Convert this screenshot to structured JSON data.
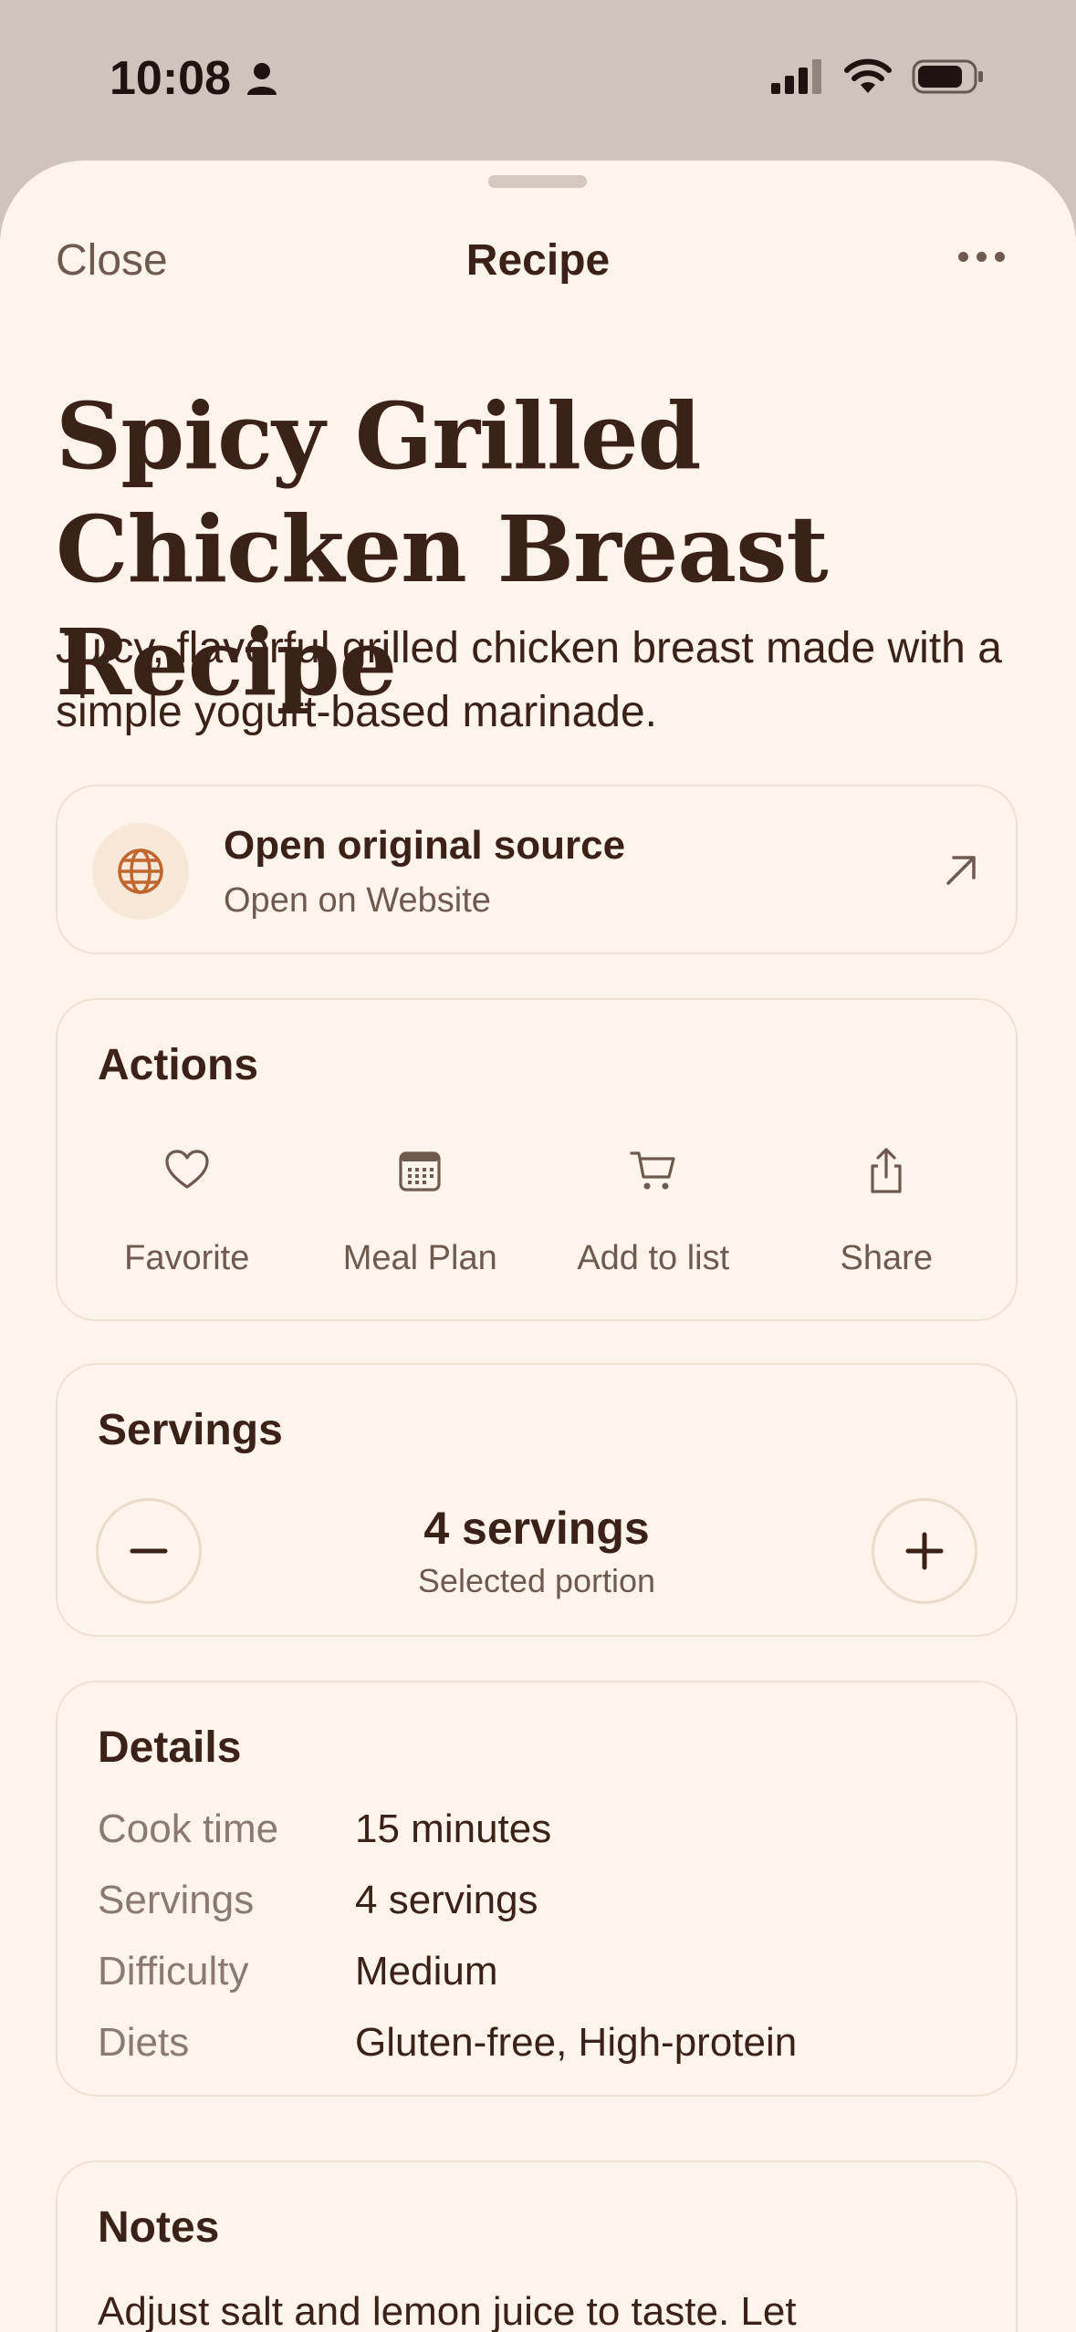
{
  "status_bar": {
    "time": "10:08",
    "icons": [
      "person-icon",
      "cellular-signal-icon",
      "wifi-icon",
      "battery-icon"
    ]
  },
  "nav": {
    "close_label": "Close",
    "title": "Recipe",
    "more_icon": "ellipsis-icon"
  },
  "recipe": {
    "title": "Spicy Grilled Chicken Breast Recipe",
    "description": "Juicy, flavorful grilled chicken breast made with a simple yogurt-based marinade."
  },
  "source": {
    "title": "Open original source",
    "subtitle": "Open on Website",
    "icon": "globe-icon",
    "trailing_icon": "arrow-up-right-icon"
  },
  "actions": {
    "heading": "Actions",
    "items": [
      {
        "label": "Favorite",
        "icon": "heart-icon"
      },
      {
        "label": "Meal Plan",
        "icon": "calendar-icon"
      },
      {
        "label": "Add to list",
        "icon": "cart-icon"
      },
      {
        "label": "Share",
        "icon": "share-icon"
      }
    ]
  },
  "servings": {
    "heading": "Servings",
    "value": "4 servings",
    "subtitle": "Selected portion"
  },
  "details": {
    "heading": "Details",
    "rows": [
      {
        "key": "Cook time",
        "value": "15 minutes"
      },
      {
        "key": "Servings",
        "value": "4 servings"
      },
      {
        "key": "Difficulty",
        "value": "Medium"
      },
      {
        "key": "Diets",
        "value": "Gluten-free, High-protein"
      }
    ]
  },
  "notes": {
    "heading": "Notes",
    "text": "Adjust salt and lemon juice to taste. Let"
  },
  "colors": {
    "background": "#fdf5eb",
    "text_primary": "#3b2218",
    "text_secondary": "#6f5a50",
    "accent": "#c0662e",
    "border": "#efe2d4",
    "status_bar": "#cdc4bb"
  }
}
